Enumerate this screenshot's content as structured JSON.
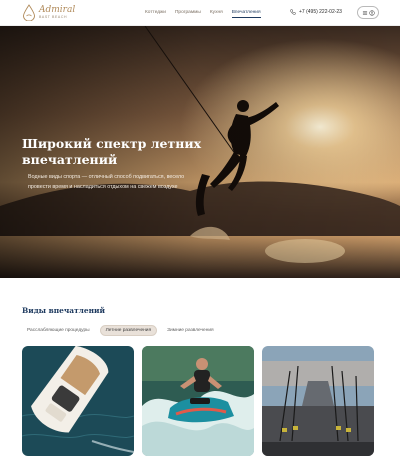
{
  "header": {
    "logo": {
      "name": "Admiral",
      "tagline": "BAST BEACH"
    },
    "nav": [
      {
        "label": "Коттеджи",
        "active": false
      },
      {
        "label": "Программы",
        "active": false
      },
      {
        "label": "Кухня",
        "active": false
      },
      {
        "label": "Впечатления",
        "active": true
      }
    ],
    "phone": "+7 (495) 222-02-23",
    "menu_icon": "hamburger-icon",
    "account_icon": "user-icon",
    "phone_icon": "phone-icon"
  },
  "hero": {
    "title": "Широкий спектр летних впечатлений",
    "text": "Водные виды спорта — отличный способ подвигаться, весело провести время и насладиться отдыхом на свежем воздухе"
  },
  "section": {
    "title": "Виды впечатлений",
    "tabs": [
      {
        "label": "Расслабляющие процедуры",
        "active": false
      },
      {
        "label": "Летние развлечения",
        "active": true
      },
      {
        "label": "Зимние развлечения",
        "active": false
      }
    ]
  },
  "colors": {
    "accent": "#1e3a5f",
    "brand": "#b08a5a",
    "active_tab_bg": "#e9e1d9"
  }
}
